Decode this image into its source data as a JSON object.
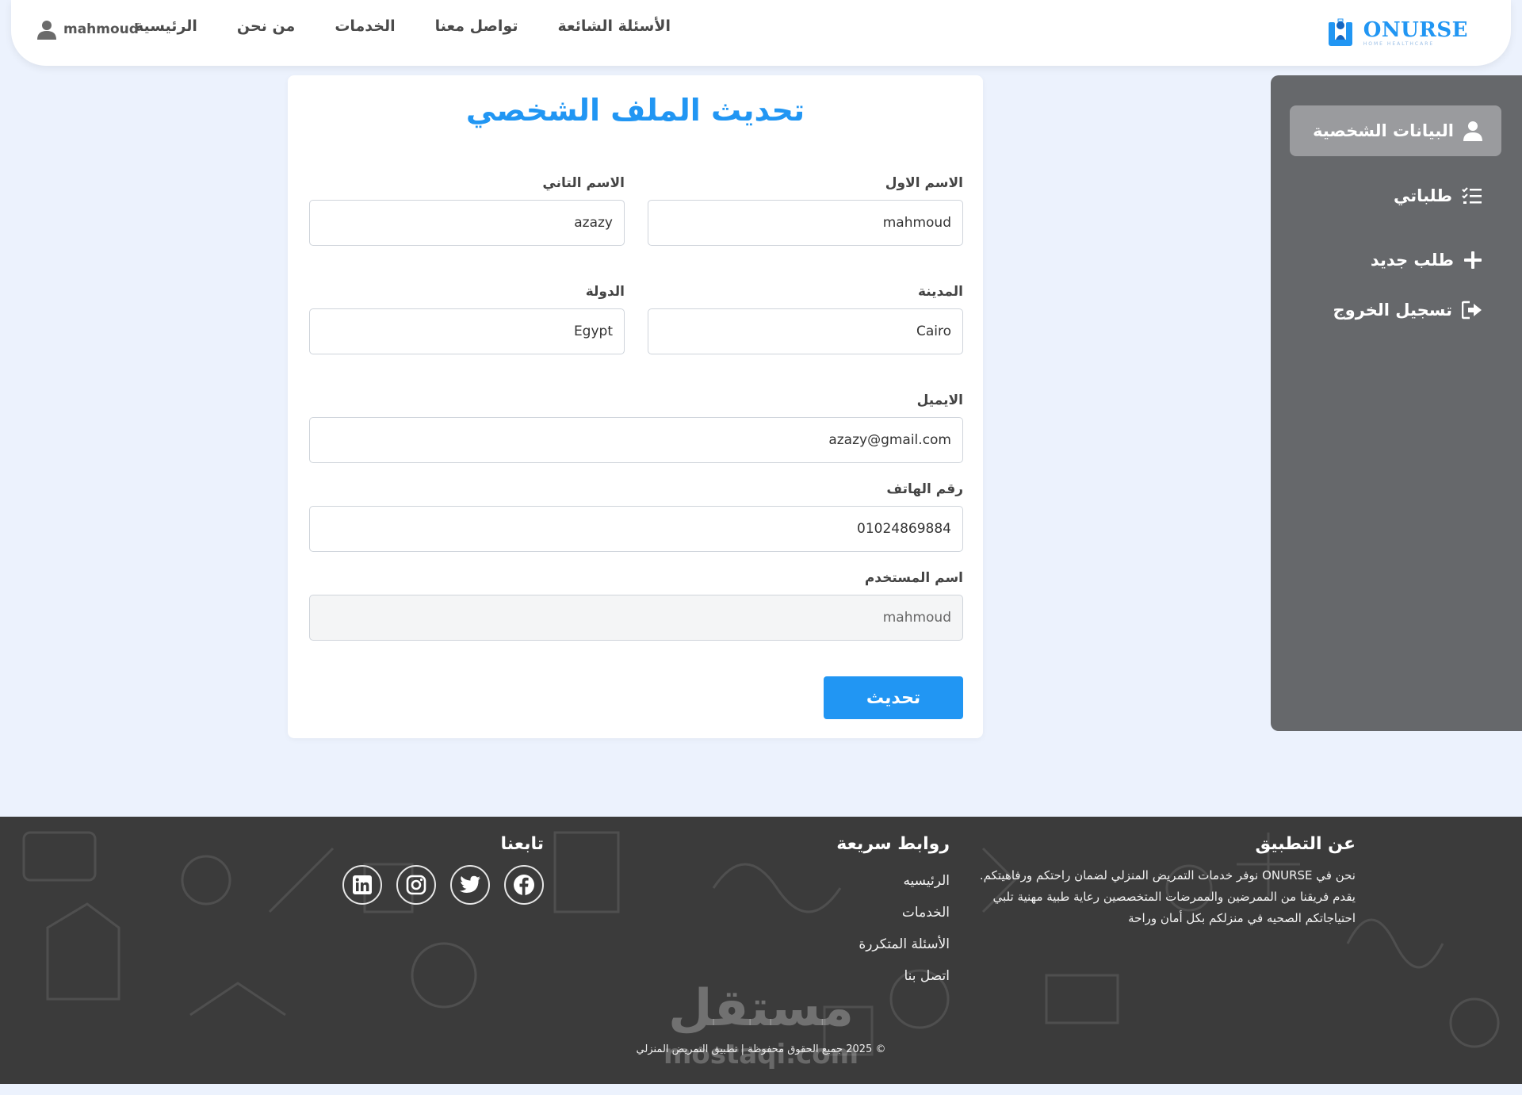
{
  "header": {
    "logo_word": "ONURSE",
    "logo_tag": "HOME HEALTHCARE",
    "nav": [
      "الرئيسية",
      "من نحن",
      "الخدمات",
      "تواصل معنا",
      "الأسئلة الشائعة"
    ],
    "user": "mahmoud"
  },
  "sidebar": {
    "items": [
      {
        "label": "البيانات الشخصية",
        "icon": "user-icon",
        "active": true
      },
      {
        "label": "طلباتي",
        "icon": "list-check-icon",
        "active": false
      },
      {
        "label": "طلب جديد",
        "icon": "plus-icon",
        "active": false
      },
      {
        "label": "تسجيل الخروج",
        "icon": "logout-icon",
        "active": false
      }
    ]
  },
  "form": {
    "title": "تحديث الملف الشخصي",
    "first_name": {
      "label": "الاسم الاول",
      "value": "mahmoud"
    },
    "second_name": {
      "label": "الاسم التاني",
      "value": "azazy"
    },
    "city": {
      "label": "المدينة",
      "value": "Cairo"
    },
    "country": {
      "label": "الدولة",
      "value": "Egypt"
    },
    "email": {
      "label": "الايميل",
      "value": "azazy@gmail.com"
    },
    "phone": {
      "label": "رقم الهاتف",
      "value": "01024869884"
    },
    "username": {
      "label": "اسم المستخدم",
      "value": "mahmoud"
    },
    "submit": "تحديث"
  },
  "footer": {
    "about_title": "عن التطبيق",
    "about_text": "نحن في ONURSE نوفر خدمات التمريض المنزلي لضمان راحتكم ورفاهيتكم. يقدم فريقنا من الممرضين والممرضات المتخصصين رعاية طبية مهنية تلبي احتياجاتكم الصحيه في منزلكم بكل أمان وراحة",
    "links_title": "روابط سريعة",
    "links": [
      "الرئيسيه",
      "الخدمات",
      "الأسئلة المتكررة",
      "اتصل بنا"
    ],
    "follow_title": "تابعنا",
    "socials": [
      "facebook-icon",
      "twitter-icon",
      "instagram-icon",
      "linkedin-icon"
    ],
    "watermark": "مستقل",
    "watermark_sub": "mostaqi.com",
    "copyright": "© 2025 جميع الحقوق محفوظة | تطبيق التمريض المنزلي"
  },
  "colors": {
    "accent": "#2196f3",
    "sidebar": "#66686b",
    "sidebar_active": "#9a9b9e",
    "footer": "#3b3b3b",
    "page_bg": "#ecf2fd"
  }
}
